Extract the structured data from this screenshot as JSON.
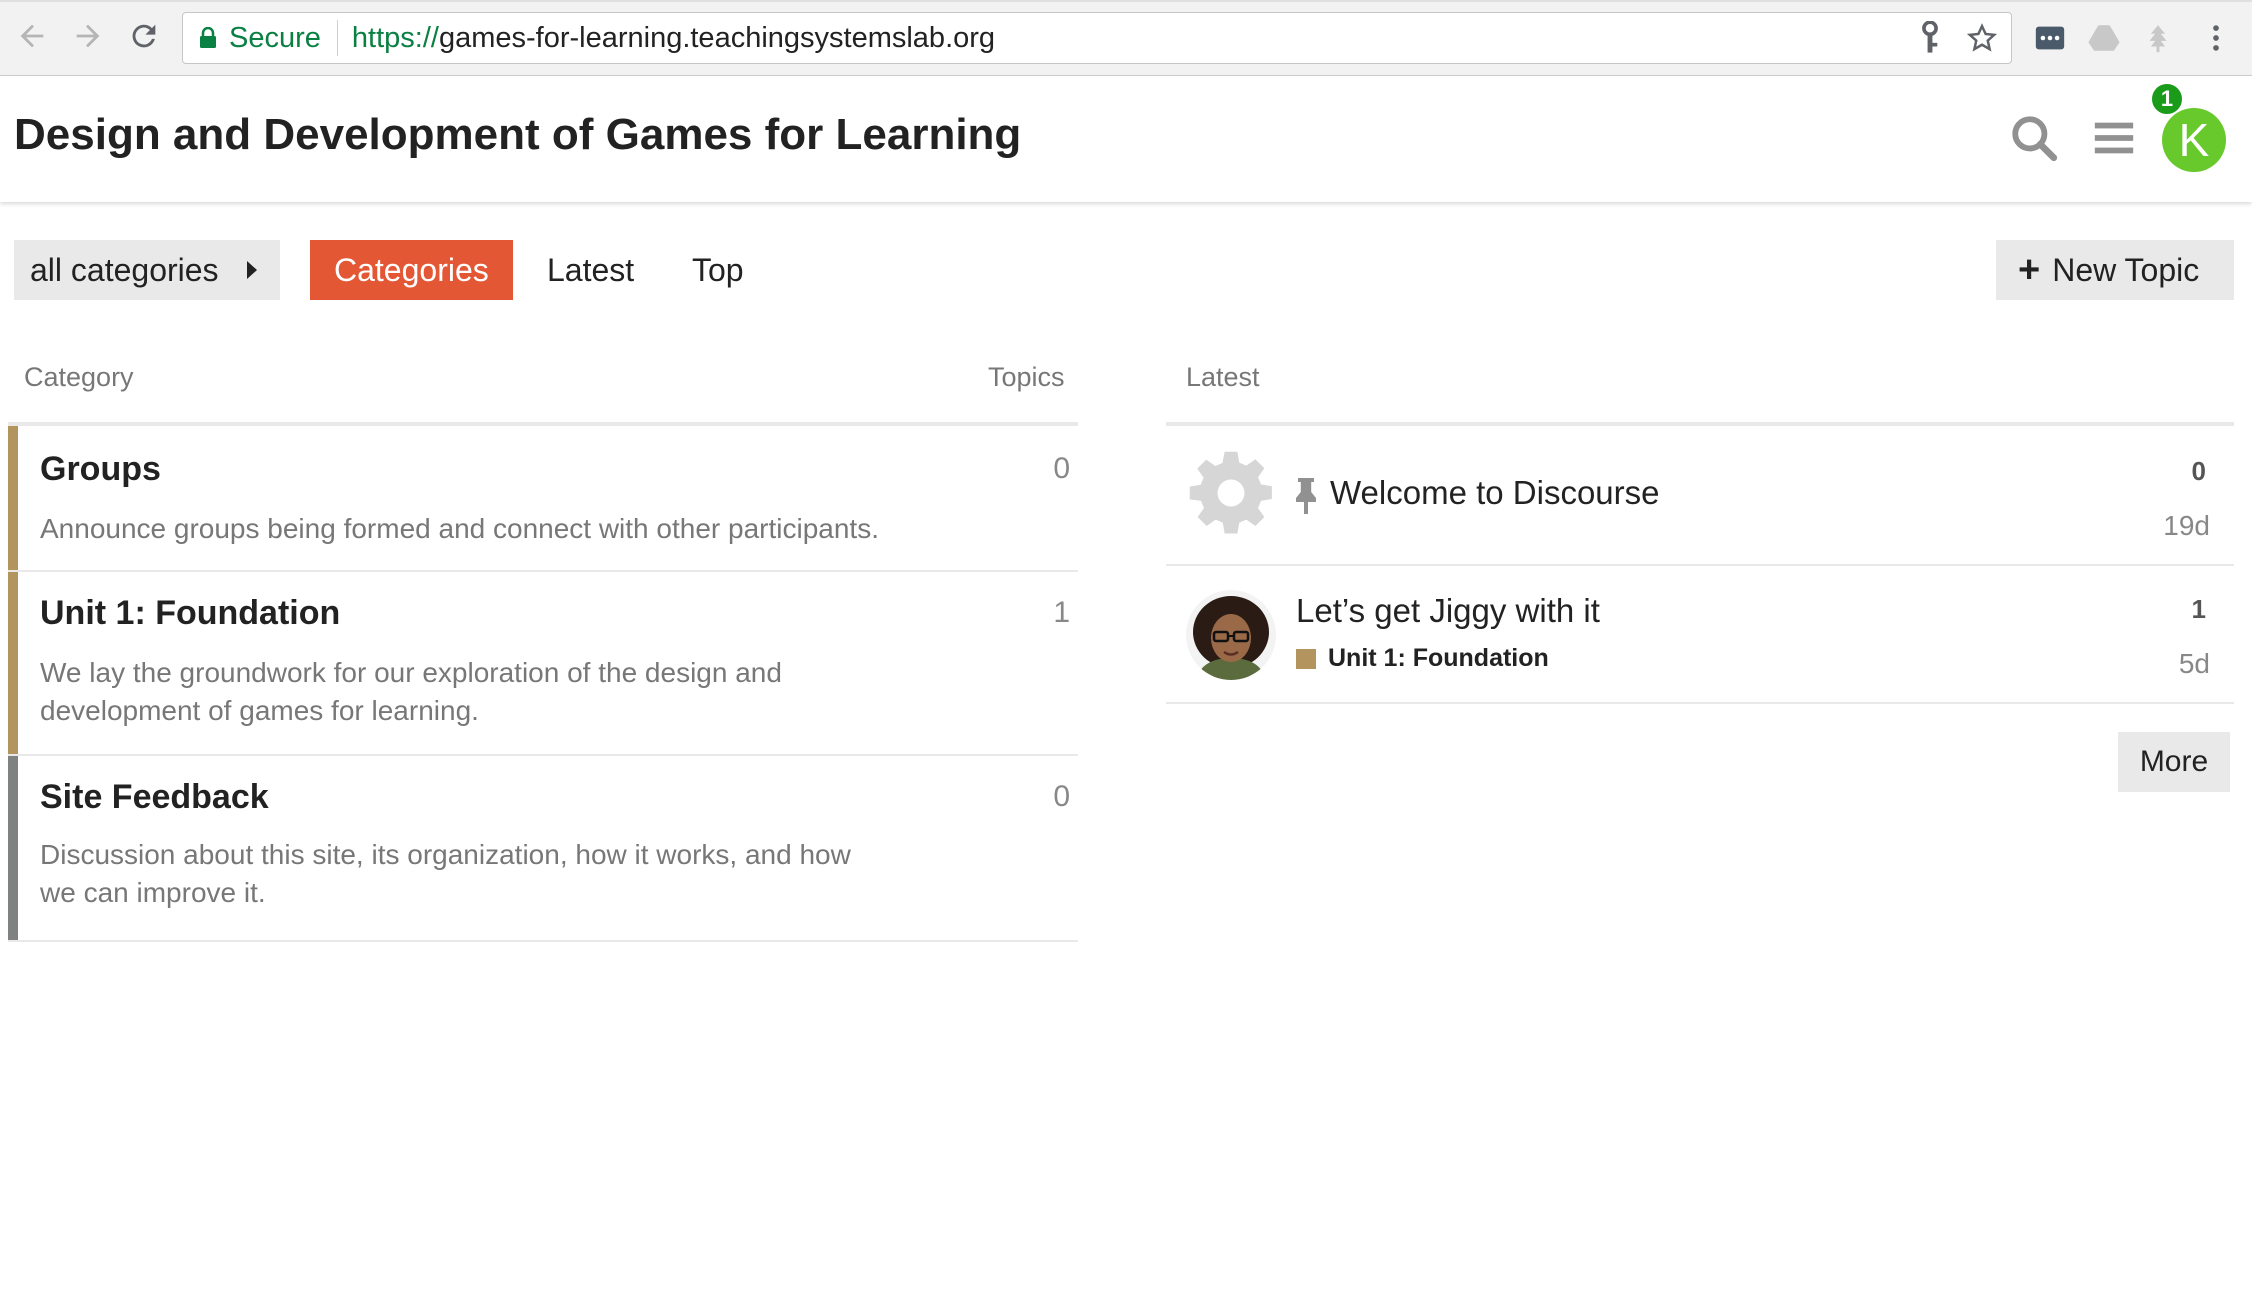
{
  "browser": {
    "secure_label": "Secure",
    "url_scheme": "https://",
    "url_host": "games-for-learning.teachingsystemslab.org",
    "icons": [
      "back-arrow-icon",
      "forward-arrow-icon",
      "reload-icon",
      "lock-icon",
      "key-icon",
      "star-icon",
      "extension-dots-icon",
      "drive-icon",
      "extension-tree-icon",
      "kebab-menu-icon"
    ]
  },
  "header": {
    "title": "Design and Development of Games for Learning",
    "notification_count": "1",
    "avatar_letter": "K",
    "avatar_color": "#67c92c"
  },
  "nav": {
    "dropdown_label": "all categories",
    "tabs": [
      {
        "label": "Categories",
        "active": true
      },
      {
        "label": "Latest",
        "active": false
      },
      {
        "label": "Top",
        "active": false
      }
    ],
    "new_topic_label": "New Topic",
    "accent": "#e45735"
  },
  "categories": {
    "header_category": "Category",
    "header_topics": "Topics",
    "rows": [
      {
        "name": "Groups",
        "description": "Announce groups being formed and connect with other participants.",
        "topics": "0",
        "color": "#b3945f"
      },
      {
        "name": "Unit 1: Foundation",
        "description": "We lay the groundwork for our exploration of the design and development of games for learning.",
        "topics": "1",
        "color": "#b3945f"
      },
      {
        "name": "Site Feedback",
        "description": "Discussion about this site, its organization, how it works, and how we can improve it.",
        "topics": "0",
        "color": "#808281"
      }
    ]
  },
  "latest": {
    "header": "Latest",
    "topics": [
      {
        "title": "Welcome to Discourse",
        "pinned": true,
        "replies": "0",
        "age": "19d"
      },
      {
        "title": "Let’s get Jiggy with it",
        "category": "Unit 1: Foundation",
        "category_color": "#b3945f",
        "replies": "1",
        "age": "5d"
      }
    ],
    "more_label": "More"
  }
}
